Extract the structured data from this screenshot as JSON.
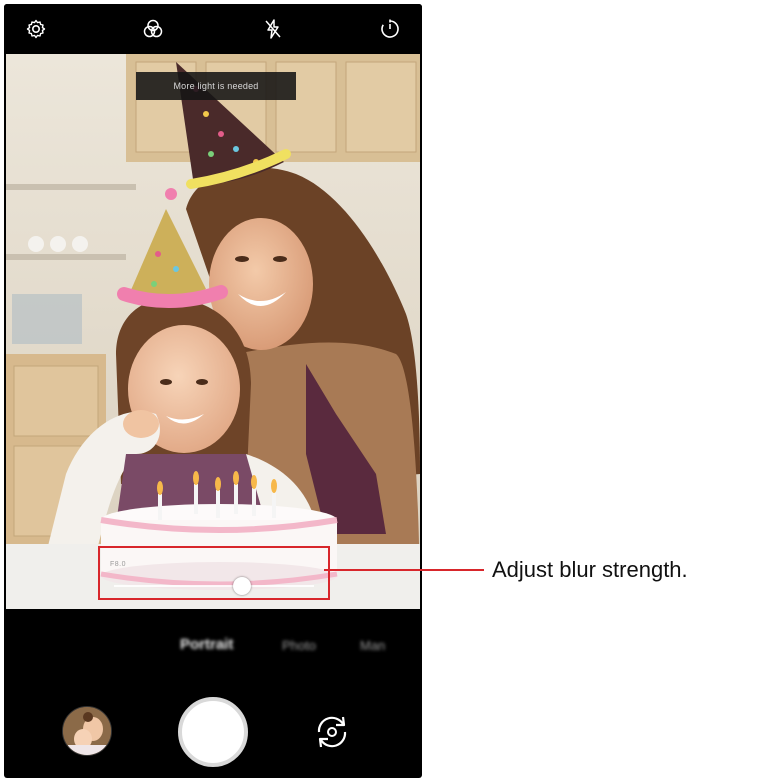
{
  "camera": {
    "toast": "More light is needed",
    "blur_label": "F8.0",
    "blur_strength": 0.64,
    "modes": [
      "Portrait",
      "Photo",
      "Man"
    ],
    "selected_mode": "Portrait",
    "top_icons": [
      "settings-icon",
      "filter-icon",
      "flash-off-icon",
      "timer-icon"
    ],
    "bottom_icons": [
      "gallery-thumbnail",
      "shutter-button",
      "switch-camera-icon"
    ]
  },
  "annotation": {
    "text": "Adjust blur strength.",
    "color": "#d8262b"
  }
}
